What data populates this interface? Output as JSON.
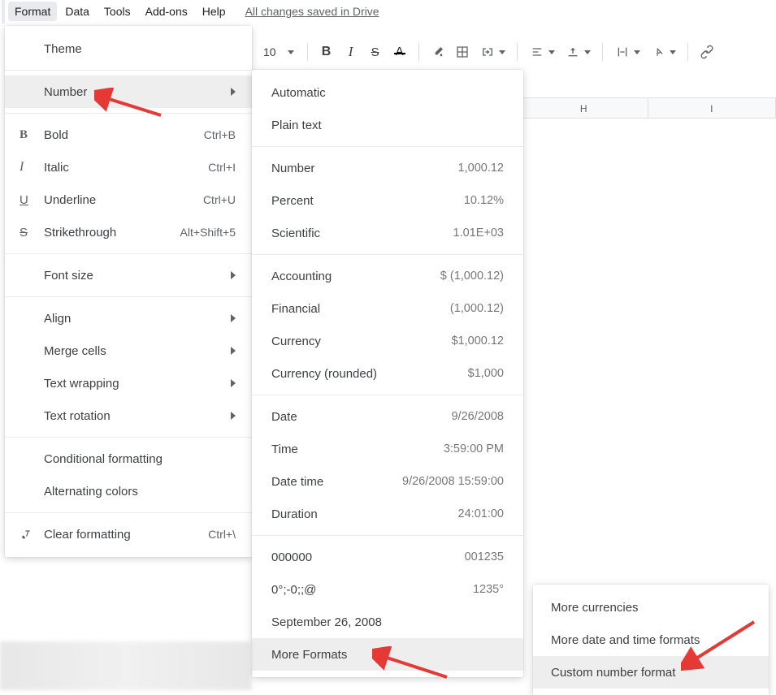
{
  "menubar": {
    "items": [
      "Format",
      "Data",
      "Tools",
      "Add-ons",
      "Help"
    ],
    "saved_status": "All changes saved in Drive"
  },
  "toolbar": {
    "font_size": "10"
  },
  "columns": [
    "H",
    "I"
  ],
  "format_menu": {
    "theme": "Theme",
    "number": "Number",
    "bold": {
      "label": "Bold",
      "shortcut": "Ctrl+B"
    },
    "italic": {
      "label": "Italic",
      "shortcut": "Ctrl+I"
    },
    "underline": {
      "label": "Underline",
      "shortcut": "Ctrl+U"
    },
    "strike": {
      "label": "Strikethrough",
      "shortcut": "Alt+Shift+5"
    },
    "font_size": "Font size",
    "align": "Align",
    "merge": "Merge cells",
    "wrap": "Text wrapping",
    "rotation": "Text rotation",
    "conditional": "Conditional formatting",
    "alternating": "Alternating colors",
    "clear": {
      "label": "Clear formatting",
      "shortcut": "Ctrl+\\"
    }
  },
  "number_menu": {
    "automatic": "Automatic",
    "plain": "Plain text",
    "number": {
      "label": "Number",
      "sample": "1,000.12"
    },
    "percent": {
      "label": "Percent",
      "sample": "10.12%"
    },
    "scientific": {
      "label": "Scientific",
      "sample": "1.01E+03"
    },
    "accounting": {
      "label": "Accounting",
      "sample": "$ (1,000.12)"
    },
    "financial": {
      "label": "Financial",
      "sample": "(1,000.12)"
    },
    "currency": {
      "label": "Currency",
      "sample": "$1,000.12"
    },
    "currency_rounded": {
      "label": "Currency (rounded)",
      "sample": "$1,000"
    },
    "date": {
      "label": "Date",
      "sample": "9/26/2008"
    },
    "time": {
      "label": "Time",
      "sample": "3:59:00 PM"
    },
    "datetime": {
      "label": "Date time",
      "sample": "9/26/2008 15:59:00"
    },
    "duration": {
      "label": "Duration",
      "sample": "24:01:00"
    },
    "custom1": {
      "label": "000000",
      "sample": "001235"
    },
    "custom2": {
      "label": "0°;-0;;@",
      "sample": "1235°"
    },
    "custom3": {
      "label": "September 26, 2008",
      "sample": ""
    },
    "more": "More Formats"
  },
  "more_formats_menu": {
    "currencies": "More currencies",
    "datetime": "More date and time formats",
    "custom": "Custom number format"
  }
}
